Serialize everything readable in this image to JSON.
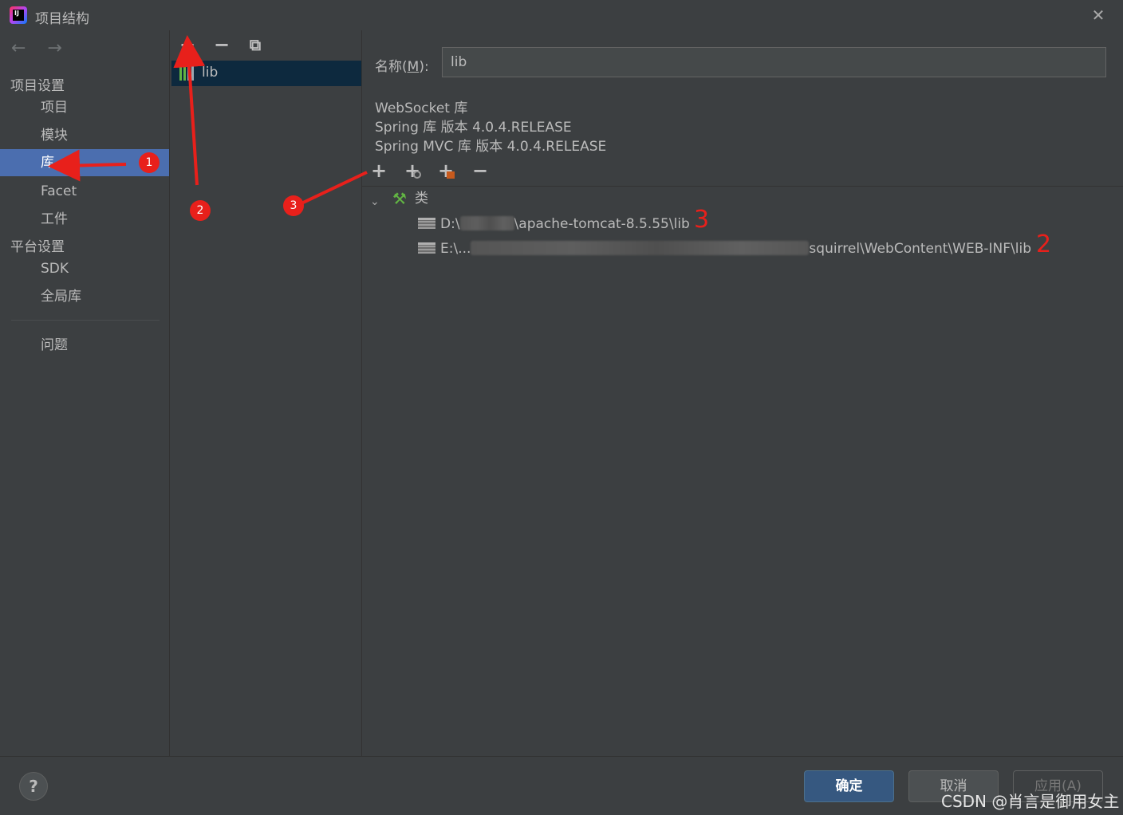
{
  "window": {
    "title": "项目结构",
    "app_icon_text": "IJ"
  },
  "sidebar": {
    "nav": {
      "back": "←",
      "forward": "→"
    },
    "project_settings_header": "项目设置",
    "platform_settings_header": "平台设置",
    "items": [
      {
        "label": "项目"
      },
      {
        "label": "模块"
      },
      {
        "label": "库",
        "selected": true
      },
      {
        "label": "Facet"
      },
      {
        "label": "工件"
      },
      {
        "label": "SDK"
      },
      {
        "label": "全局库"
      },
      {
        "label": "问题"
      }
    ]
  },
  "middle": {
    "toolbar": {
      "add": "+",
      "remove": "−",
      "copy": "⧉"
    },
    "libraries": [
      {
        "label": "lib"
      }
    ]
  },
  "detail": {
    "name_label_prefix": "名称(",
    "name_label_mnemonic": "M",
    "name_label_suffix": "):",
    "name_value": "lib",
    "descriptions": [
      "WebSocket 库",
      "Spring 库  版本 4.0.4.RELEASE",
      "Spring MVC 库  版本 4.0.4.RELEASE"
    ],
    "tree_toolbar": {
      "add": "+",
      "add_web": "+",
      "add_jar": "+",
      "remove": "−"
    },
    "tree": {
      "root_label": "类",
      "entries": [
        {
          "prefix": "D:\\",
          "suffix": "\\apache-tomcat-8.5.55\\lib"
        },
        {
          "prefix": "E:\\...",
          "suffix": "squirrel\\WebContent\\WEB-INF\\lib"
        }
      ]
    }
  },
  "annotations": {
    "circle_1": "1",
    "circle_2": "2",
    "circle_3": "3",
    "red_mark_3": "3",
    "red_mark_2": "2"
  },
  "footer": {
    "help": "?",
    "ok": "确定",
    "cancel": "取消",
    "apply": "应用(A)",
    "watermark": "CSDN @肖言是御用女主"
  },
  "colors": {
    "selected_bg": "#4b6eaf",
    "annotation_red": "#e8201b",
    "ok_button": "#365880"
  }
}
